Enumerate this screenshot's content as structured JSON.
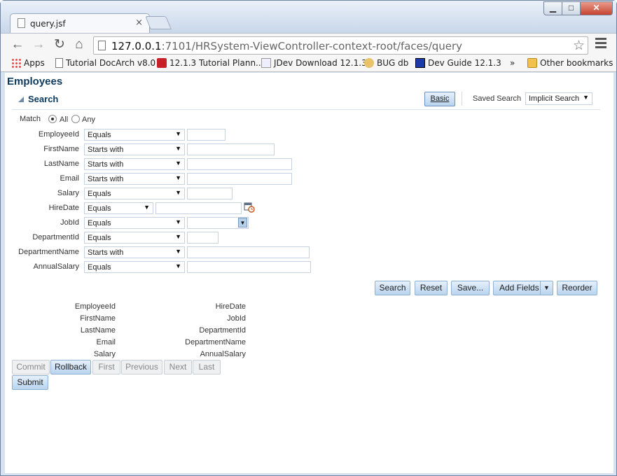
{
  "browser": {
    "tab_title": "query.jsf",
    "tab_close": "×",
    "url_host": "127.0.0.1",
    "url_path": ":7101/HRSystem-ViewController-context-root/faces/query",
    "window_min": "▁",
    "window_max": "□",
    "window_close": "✕",
    "nav": {
      "back": "←",
      "forward": "→",
      "reload": "↻",
      "home": "⌂",
      "star": "☆"
    }
  },
  "bookmarks": {
    "items": [
      {
        "label": "Apps"
      },
      {
        "label": "Tutorial DocArch v8.0"
      },
      {
        "label": "12.1.3 Tutorial Plann..."
      },
      {
        "label": "JDev Download 12.1.3"
      },
      {
        "label": "BUG db"
      },
      {
        "label": "Dev Guide 12.1.3"
      }
    ],
    "overflow": "»",
    "other": "Other bookmarks"
  },
  "page": {
    "title": "Employees",
    "search_header": "Search",
    "basic_button": "Basic",
    "saved_search_label": "Saved Search",
    "saved_search_value": "Implicit Search",
    "match_label": "Match",
    "match_all": "All",
    "match_any": "Any"
  },
  "fields": [
    {
      "label": "EmployeeId",
      "operator": "Equals"
    },
    {
      "label": "FirstName",
      "operator": "Starts with"
    },
    {
      "label": "LastName",
      "operator": "Starts with"
    },
    {
      "label": "Email",
      "operator": "Starts with"
    },
    {
      "label": "Salary",
      "operator": "Equals"
    },
    {
      "label": "HireDate",
      "operator": "Equals"
    },
    {
      "label": "JobId",
      "operator": "Equals"
    },
    {
      "label": "DepartmentId",
      "operator": "Equals"
    },
    {
      "label": "DepartmentName",
      "operator": "Starts with"
    },
    {
      "label": "AnnualSalary",
      "operator": "Equals"
    }
  ],
  "actions": {
    "search": "Search",
    "reset": "Reset",
    "save": "Save...",
    "add_fields": "Add Fields",
    "reorder": "Reorder"
  },
  "results": {
    "left": [
      "EmployeeId",
      "FirstName",
      "LastName",
      "Email",
      "Salary"
    ],
    "right": [
      "HireDate",
      "JobId",
      "DepartmentId",
      "DepartmentName",
      "AnnualSalary"
    ]
  },
  "nav_buttons": {
    "commit": "Commit",
    "rollback": "Rollback",
    "first": "First",
    "previous": "Previous",
    "next": "Next",
    "last": "Last",
    "submit": "Submit"
  }
}
